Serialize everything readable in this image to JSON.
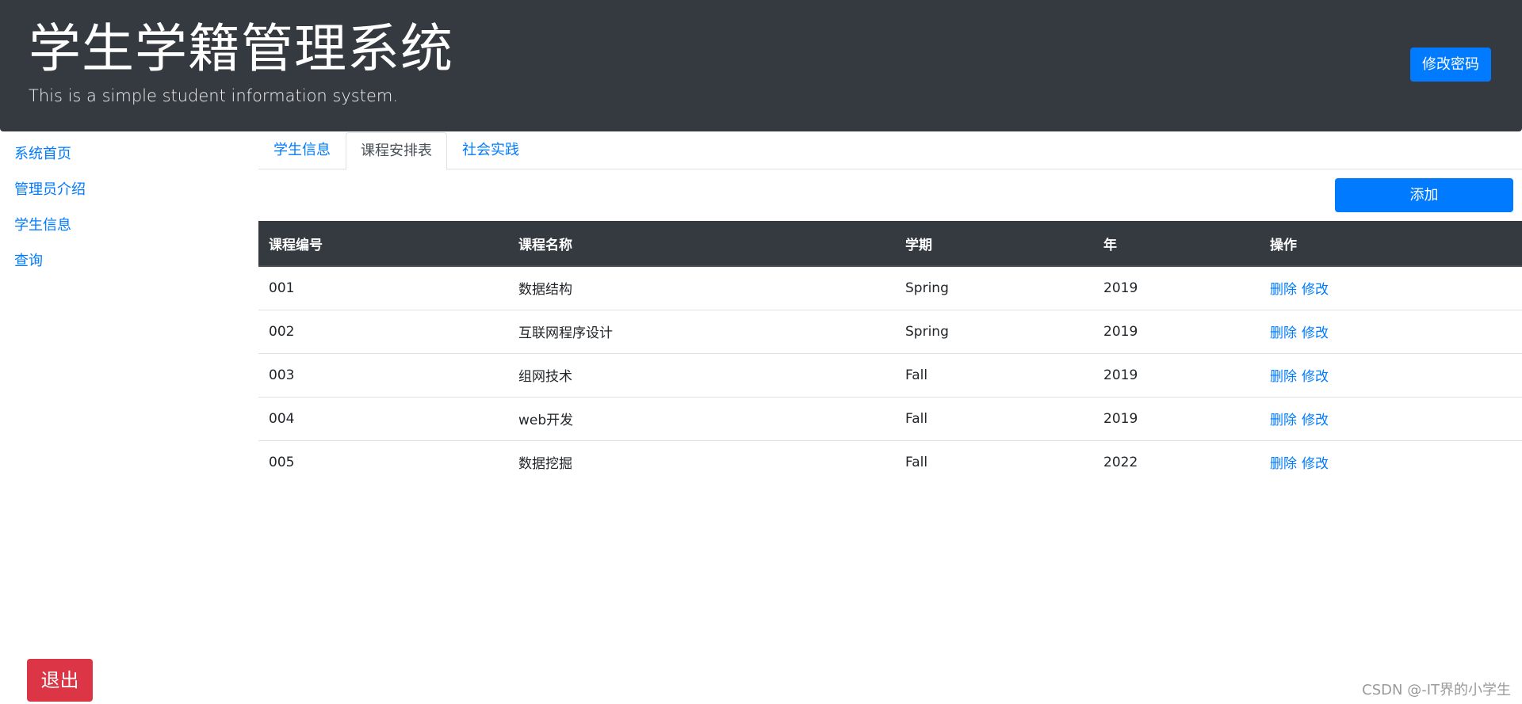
{
  "header": {
    "title": "学生学籍管理系统",
    "subtitle": "This is a simple student information system.",
    "change_password_label": "修改密码"
  },
  "sidebar": {
    "items": [
      {
        "label": "系统首页"
      },
      {
        "label": "管理员介绍"
      },
      {
        "label": "学生信息"
      },
      {
        "label": "查询"
      }
    ]
  },
  "tabs": [
    {
      "label": "学生信息",
      "active": false
    },
    {
      "label": "课程安排表",
      "active": true
    },
    {
      "label": "社会实践",
      "active": false
    }
  ],
  "toolbar": {
    "add_label": "添加"
  },
  "table": {
    "columns": [
      "课程编号",
      "课程名称",
      "学期",
      "年",
      "操作"
    ],
    "rows": [
      {
        "id": "001",
        "name": "数据结构",
        "term": "Spring",
        "year": "2019",
        "delete": "删除",
        "edit": "修改"
      },
      {
        "id": "002",
        "name": "互联网程序设计",
        "term": "Spring",
        "year": "2019",
        "delete": "删除",
        "edit": "修改"
      },
      {
        "id": "003",
        "name": "组网技术",
        "term": "Fall",
        "year": "2019",
        "delete": "删除",
        "edit": "修改"
      },
      {
        "id": "004",
        "name": "web开发",
        "term": "Fall",
        "year": "2019",
        "delete": "删除",
        "edit": "修改"
      },
      {
        "id": "005",
        "name": "数据挖掘",
        "term": "Fall",
        "year": "2022",
        "delete": "删除",
        "edit": "修改"
      }
    ]
  },
  "footer": {
    "logout_label": "退出",
    "watermark": "CSDN @-IT界的小学生"
  },
  "colors": {
    "header_bg": "#343a40",
    "primary": "#007bff",
    "danger": "#dc3545"
  }
}
